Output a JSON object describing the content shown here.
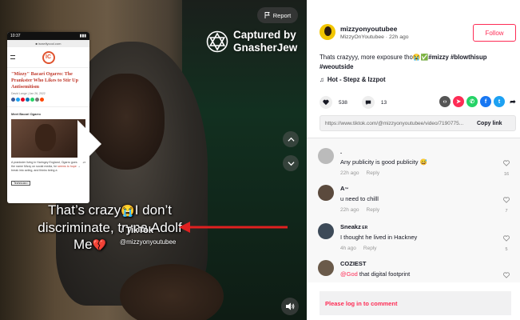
{
  "video": {
    "report_label": "Report",
    "watermark": {
      "line1": "Captured by",
      "line2": "GnasherJew"
    },
    "caption": {
      "line1a": "That’s crazy",
      "line1b": "I don’t",
      "line2": "discriminate, tryna Adolf",
      "line3": "Me"
    },
    "tiktok_label": "TikTok",
    "tiktok_handle": "@mizzyonyoutubee",
    "arrow_color": "#e02020"
  },
  "phone_screenshot": {
    "time": "10:37",
    "url": "■ israellycool.com",
    "logo": "IC",
    "article_title": "\"Mizzy\" Bacari Ogarro: The Prankster Who Likes to Stir Up Antisemitism",
    "byline": "David Lange  |  Jan 26, 2022",
    "meet_label": "Meet Bacari Ogarro",
    "body_text_start": "A prankster living in Haringey England, Ogarro goes under the name Mizzy on social media, he ",
    "body_text_link": "seems to hope",
    "body_text_end": " to break into acting, and thinks being a",
    "tag": "Technician I"
  },
  "panel": {
    "author": {
      "username": "mizzyonyoutubee",
      "display": "MizzyOnYoutubee",
      "time": "22h ago"
    },
    "follow_label": "Follow",
    "description": {
      "text": "Thats crazyyy, more exposure tho",
      "hashtags": "#mizzy #blowthisup #weoutside"
    },
    "music": "Hot - Stepz & Izzpot",
    "likes": "538",
    "comments_count": "13",
    "link": "https://www.tiktok.com/@mizzyonyoutubee/video/7190775...",
    "copy_link_label": "Copy link",
    "login_label": "Please log in to comment"
  },
  "comments": [
    {
      "name": ".",
      "name_suffix": "",
      "text": "Any publicity is good publicity ",
      "mention": "",
      "time": "22h ago",
      "reply": "Reply",
      "likes": "16"
    },
    {
      "name": "A",
      "name_suffix": "™",
      "text": "u need to chilll",
      "mention": "",
      "time": "22h ago",
      "reply": "Reply",
      "likes": "7"
    },
    {
      "name": "Sneakz",
      "name_suffix": " ER",
      "text": "I thought he lived in Hackney",
      "mention": "",
      "time": "4h ago",
      "reply": "Reply",
      "likes": "5"
    },
    {
      "name": "COZIEST",
      "name_suffix": "",
      "text": " that digital footprint",
      "mention": "@God",
      "time": "",
      "reply": "",
      "likes": ""
    }
  ],
  "colors": {
    "accent": "#fe2c55",
    "text": "#161823"
  },
  "icons": [
    "flag-icon",
    "star-of-david-icon",
    "chevron-up-icon",
    "chevron-down-icon",
    "volume-icon",
    "heart-icon",
    "comment-icon",
    "music-note-icon",
    "embed-icon",
    "send-icon",
    "whatsapp-icon",
    "facebook-icon",
    "twitter-icon",
    "share-icon"
  ]
}
